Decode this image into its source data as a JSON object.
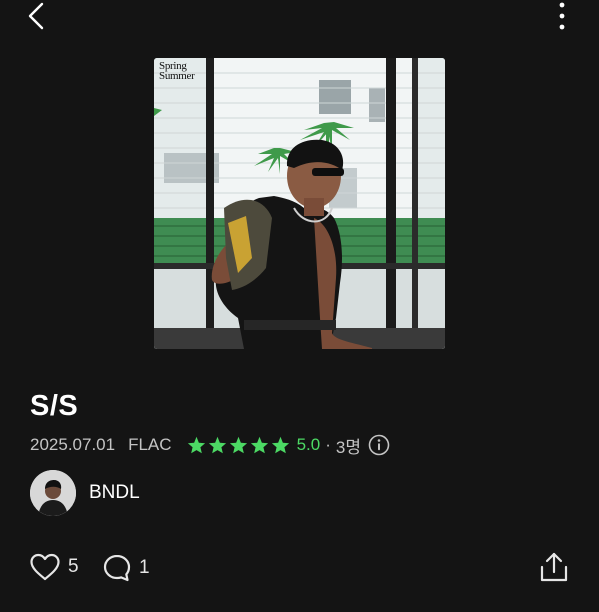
{
  "album": {
    "title": "S/S",
    "release_date": "2025.07.01",
    "format": "FLAC",
    "rating": "5.0",
    "separator": "·",
    "rating_count": "3명",
    "stars_filled": 5,
    "cover_logo": [
      "Spring",
      "Summer"
    ]
  },
  "artist": {
    "name": "BNDL"
  },
  "actions": {
    "like_count": "5",
    "comment_count": "1"
  },
  "colors": {
    "background": "#141414",
    "accent_green": "#4cd964",
    "meta_gray": "#c4c4c4"
  },
  "icons": {
    "back": "chevron-left-icon",
    "more": "more-vertical-icon",
    "star": "star-icon",
    "info": "info-icon",
    "like": "heart-icon",
    "comment": "comment-icon",
    "share": "share-icon"
  }
}
